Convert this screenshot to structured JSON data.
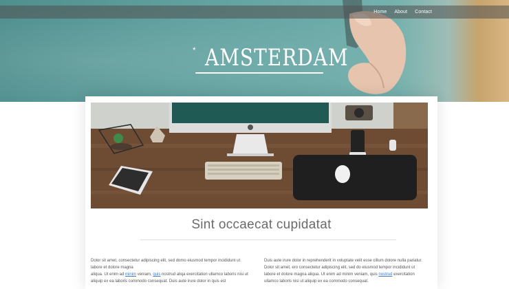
{
  "nav": {
    "items": [
      "Home",
      "About",
      "Contact"
    ]
  },
  "brand": {
    "title": "AMSTERDAM",
    "star_left": "*",
    "star_right": "*"
  },
  "article": {
    "heading": "Sint occaecat cupidatat",
    "left": {
      "line1": "Dolor sit amet, consectetur adipiscing elit, sed domo eiusmod tempor incididunt ut",
      "line2": "labore et dolore magna",
      "line3_a": "aliqua. Ut enim ad ",
      "link1": "minim",
      "line3_b": " veniam, ",
      "link2": "quis",
      "line3_c": " nostrud aliqa exercitation ullamco laboris nisi ut",
      "line4": "aliquip ex ea laboris commodo consequat. Duis aute irure dolor in quis est"
    },
    "right": {
      "line1": "Duis aute irure dolor in reprehenderit in voluptate velit esse cillum dolore nulla pariatur.",
      "line2": "Dolor sit amet, ero consectetur adipiscing elit, sed do eiusmod tempor incididunt ut",
      "line3_a": "labore et dolore magna aliqua. Ut enim ad minim veniam, quis ",
      "link1": "nostrud",
      "line3_b": " exercitation",
      "line4": "ullamco laboris nisi ut aliquip ex ea commodo consequat."
    }
  },
  "colors": {
    "hero_teal": "#5fa09e",
    "link": "#3a7ac6",
    "text": "#555555"
  },
  "icons": {
    "apple_logo": "apple-logo-icon"
  }
}
